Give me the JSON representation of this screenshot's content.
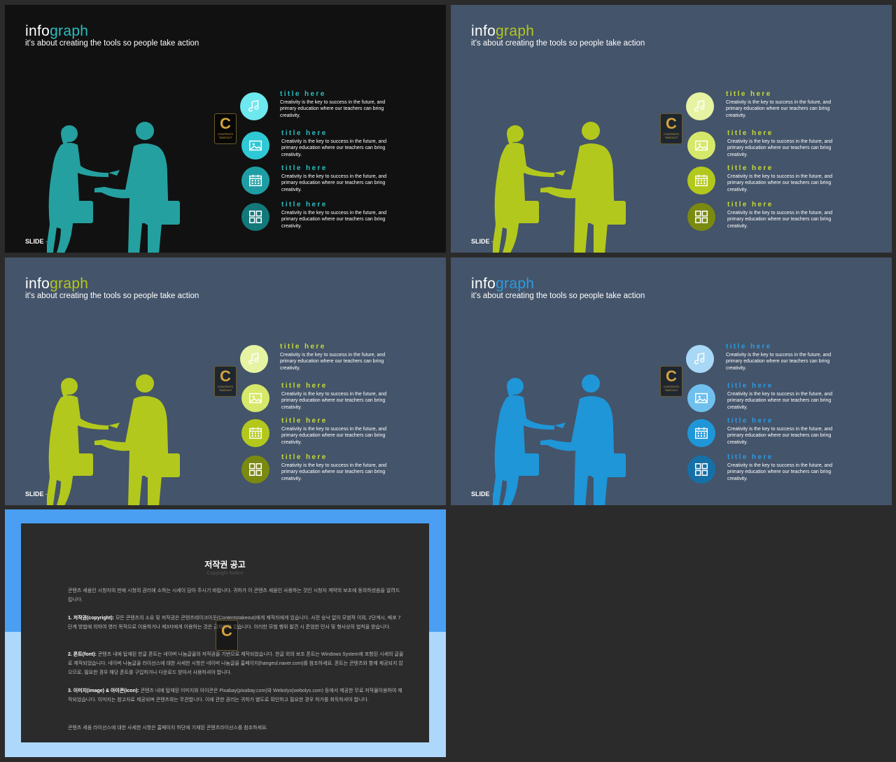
{
  "slides": [
    {
      "title_a": "info",
      "title_b": "graph",
      "subtitle": "it's about creating the tools so people take action",
      "slide_label": "SLIDE",
      "bg": "#111111",
      "accent": "#25a0a0",
      "title_accent": "#2abfbf",
      "item_title_color": "#2abfbf",
      "circles": [
        "#6ee8ef",
        "#2fc9d6",
        "#1e9ea4",
        "#13787a"
      ],
      "items": [
        {
          "icon": "music-icon",
          "title": "title here",
          "text": "Creativity is the key to success in the future, and primary education where our teachers can bring creativity."
        },
        {
          "icon": "image-icon",
          "title": "title here",
          "text": "Creativity is the key to success in the future, and primary education where our teachers can bring creativity."
        },
        {
          "icon": "calendar-icon",
          "title": "title here",
          "text": "Creativity is the key to success in the future, and primary education where our teachers can bring creativity."
        },
        {
          "icon": "grid-icon",
          "title": "title here",
          "text": "Creativity is the key to success in the future, and primary education where our teachers can bring creativity."
        }
      ]
    },
    {
      "title_a": "info",
      "title_b": "graph",
      "subtitle": "it's about creating the tools so people take action",
      "slide_label": "SLIDE",
      "bg": "#44546a",
      "accent": "#b3c81d",
      "title_accent": "#b3c81d",
      "item_title_color": "#c6dc35",
      "circles": [
        "#e6f3a3",
        "#d6e86a",
        "#b3c81d",
        "#7a8a10"
      ],
      "items": [
        {
          "icon": "music-icon",
          "title": "title here",
          "text": "Creativity is the key to success in the future, and primary education where our teachers can bring creativity."
        },
        {
          "icon": "image-icon",
          "title": "title here",
          "text": "Creativity is the key to success in the future, and primary education where our teachers can bring creativity."
        },
        {
          "icon": "calendar-icon",
          "title": "title here",
          "text": "Creativity is the key to success in the future, and primary education where our teachers can bring creativity."
        },
        {
          "icon": "grid-icon",
          "title": "title here",
          "text": "Creativity is the key to success in the future, and primary education where our teachers can bring creativity."
        }
      ]
    },
    {
      "title_a": "info",
      "title_b": "graph",
      "subtitle": "it's about creating the tools so people take action",
      "slide_label": "SLIDE",
      "bg": "#44546a",
      "accent": "#b3c81d",
      "title_accent": "#b3c81d",
      "item_title_color": "#c6dc35",
      "circles": [
        "#e6f3a3",
        "#d6e86a",
        "#b3c81d",
        "#7a8a10"
      ],
      "items": [
        {
          "icon": "music-icon",
          "title": "title here",
          "text": "Creativity is the key to success in the future, and primary education where our teachers can bring creativity."
        },
        {
          "icon": "image-icon",
          "title": "title here",
          "text": "Creativity is the key to success in the future, and primary education where our teachers can bring creativity."
        },
        {
          "icon": "calendar-icon",
          "title": "title here",
          "text": "Creativity is the key to success in the future, and primary education where our teachers can bring creativity."
        },
        {
          "icon": "grid-icon",
          "title": "title here",
          "text": "Creativity is the key to success in the future, and primary education where our teachers can bring creativity."
        }
      ]
    },
    {
      "title_a": "info",
      "title_b": "graph",
      "subtitle": "it's about creating the tools so people take action",
      "slide_label": "SLIDE",
      "bg": "#44546a",
      "accent": "#1e96d8",
      "title_accent": "#2b9be0",
      "item_title_color": "#2b9be0",
      "circles": [
        "#a8d8f5",
        "#6fc0ee",
        "#1e96d8",
        "#1570a8"
      ],
      "items": [
        {
          "icon": "music-icon",
          "title": "title here",
          "text": "Creativity is the key to success in the future, and primary education where our teachers can bring creativity."
        },
        {
          "icon": "image-icon",
          "title": "title here",
          "text": "Creativity is the key to success in the future, and primary education where our teachers can bring creativity."
        },
        {
          "icon": "calendar-icon",
          "title": "title here",
          "text": "Creativity is the key to success in the future, and primary education where our teachers can bring creativity."
        },
        {
          "icon": "grid-icon",
          "title": "title here",
          "text": "Creativity is the key to success in the future, and primary education where our teachers can bring creativity."
        }
      ]
    }
  ],
  "logo": {
    "letter": "C",
    "text": "CONTENTS TAKEOUT"
  },
  "notice": {
    "title": "저작권 공고",
    "subtitle": "Copyright Notice",
    "intro": "콘텐츠 세움인 시청자의 판에 시청의 권리에 소하는 시세이 담아 주시기 바랍니다. 귀하가 이 콘텐츠 세움인 사용하는 것인 시청자 계약의 보조에 동의하셨음을 알려드립니다.",
    "p1_head": "1. 저작권(copyright):",
    "p1_body": "모든 콘텐츠의 소유 및 저작권은 콘텐츠테이크아웃(Contentstakeout)에게 제작자에게 있습니다. 사전 승낙 없이 모범적 이외, 2단계시, 배포 7단계 방법에 의하여 영리 목적으로 이용하거나 제3자에게 이용하는 것은 금지되어 있습니다. 이러한 모범 행위 발견 시 준엄한 민사 및 형사상의 법칙을 받습니다.",
    "p2_head": "2. 폰트(font):",
    "p2_body": "콘텐츠 내에 탑재된 한글 폰트는 네이버 나눔글꼴의 저작권을 기반으로 제작되었습니다. 한글 외의 보조 폰트는 Windows System에 포함된 시세의 글꼴로 제작되었습니다. 네이버 나눔글꼴 라이선스에 대한 사세한 시항은 네이버 나눔글꼴 홈페이지(hangeul.naver.com)를 참조하세요. 폰트는 콘텐츠와 함께 제공되지 않으므로, 필요한 경우 해당 폰트를 구입하거나 다운로드 받아서 사용하셔야 합니다.",
    "p3_head": "3. 이미지(image) & 아이콘(icon):",
    "p3_body": "콘텐츠 내에 탑재된 이미지와 아이콘은 Pixabay(pixabay.com)와 Webolys(webolys.com) 등에서 제공한 무료 저작물이용하여 제작되었습니다. 이미지는 참고자료 제공되며 콘텐츠와는 무관합니다. 이에 관한 권리는 귀하가 별도로 확인하고 필요한 경우 허가를 취득하셔야 합니다.",
    "closing": "콘텐츠 세움 라이선스에 대한 사세한 시항은 홈페이지 하단에 기재된 콘텐츠라이선스를 참조하세요."
  }
}
